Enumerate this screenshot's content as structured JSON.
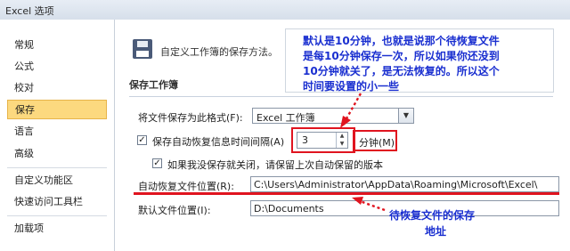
{
  "window": {
    "title": "Excel 选项"
  },
  "sidebar": {
    "items": [
      {
        "label": "常规"
      },
      {
        "label": "公式"
      },
      {
        "label": "校对"
      },
      {
        "label": "保存"
      },
      {
        "label": "语言"
      },
      {
        "label": "高级"
      },
      {
        "label": "自定义功能区"
      },
      {
        "label": "快速访问工具栏"
      },
      {
        "label": "加载项"
      }
    ],
    "active_index": 3
  },
  "main": {
    "header_text": "自定义工作簿的保存方法。",
    "header_icon": "floppy-disk-icon",
    "section_title": "保存工作簿",
    "save_format": {
      "label": "将文件保存为此格式(F):",
      "value": "Excel 工作簿"
    },
    "autorecover": {
      "label": "保存自动恢复信息时间间隔(A)",
      "checked": true,
      "value": "3",
      "unit": "分钟(M)"
    },
    "keep_last": {
      "label": "如果我没保存就关闭，请保留上次自动保留的版本",
      "checked": true
    },
    "autorecover_location": {
      "label": "自动恢复文件位置(R):",
      "value": "C:\\Users\\Administrator\\AppData\\Roaming\\Microsoft\\Excel\\"
    },
    "default_location": {
      "label": "默认文件位置(I):",
      "value": "D:\\Documents"
    }
  },
  "annotations": {
    "callout_lines": [
      "默认是10分钟，也就是说那个待恢复文件",
      "是每10分钟保存一次，所以如果你还没到",
      "10分钟就关了，是无法恢复的。所以这个",
      "时间要设置的小一些"
    ],
    "bottom_lines": [
      "待恢复文件的保存",
      "地址"
    ],
    "colors": {
      "annotation_text": "#1a2fd0",
      "highlight": "#e0141f",
      "active_nav": "#fcd97f"
    }
  }
}
